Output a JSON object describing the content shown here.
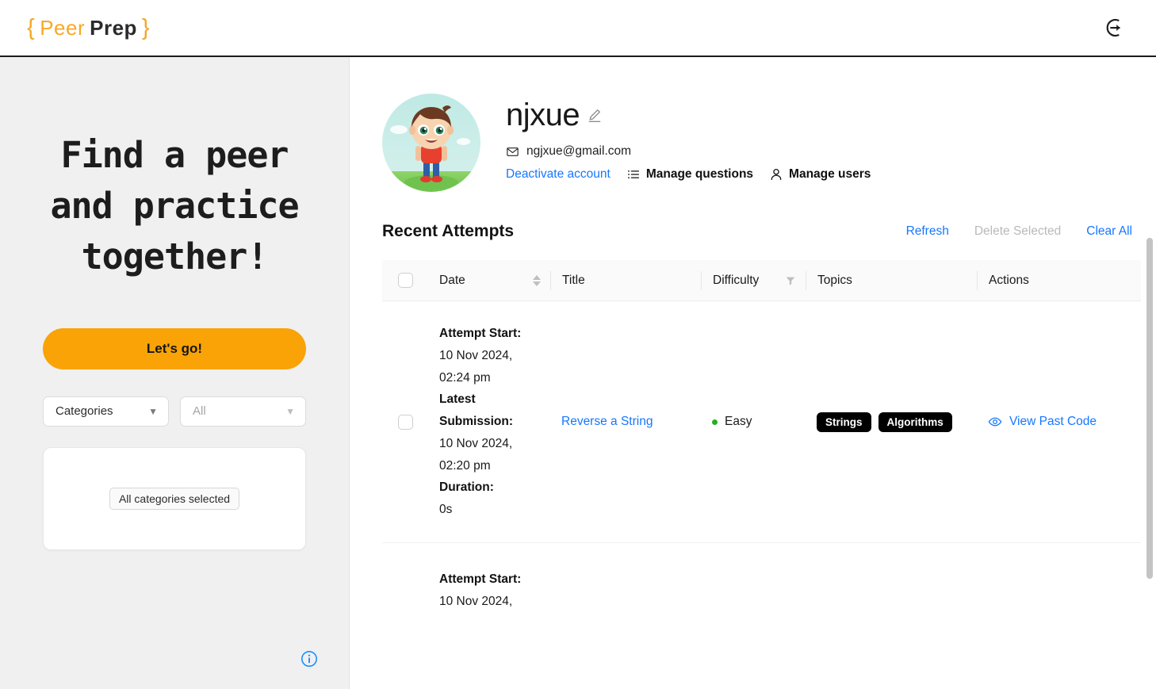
{
  "topbar": {
    "logo": {
      "open_brace": "{",
      "peer": "Peer",
      "prep": "Prep",
      "close_brace": "}"
    },
    "logout_icon": "logout-icon"
  },
  "left_panel": {
    "hero_title": "Find a peer and practice together!",
    "primary_button": "Let's go!",
    "category_select": {
      "value": "Categories",
      "chevron": "chevron-down-icon"
    },
    "difficulty_select": {
      "placeholder": "All",
      "value": "All",
      "chevron": "chevron-down-icon"
    },
    "categories_card": {
      "chip": "All categories selected"
    },
    "info_icon": "info-circle-icon"
  },
  "profile": {
    "avatar_alt": "cartoon-boy-avatar",
    "username": "njxue",
    "edit_icon": "pencil-edit-icon",
    "email": "ngjxue@gmail.com",
    "email_icon": "envelope-icon",
    "deactivate_link": "Deactivate account",
    "manage_questions": {
      "label": "Manage questions",
      "icon": "list-icon"
    },
    "manage_users": {
      "label": "Manage users",
      "icon": "person-icon"
    }
  },
  "attempts": {
    "title": "Recent Attempts",
    "actions": {
      "refresh": "Refresh",
      "delete_selected": "Delete Selected",
      "clear_all": "Clear All"
    },
    "columns": {
      "select_all": "",
      "date": "Date",
      "title": "Title",
      "difficulty": "Difficulty",
      "topics": "Topics",
      "actions": "Actions"
    },
    "column_icons": {
      "date_sort": "sort-arrows-icon",
      "difficulty_filter": "filter-funnel-icon"
    },
    "rows": [
      {
        "attempt_start_label": "Attempt Start:",
        "attempt_start_value": "10 Nov 2024, 02:24 pm",
        "latest_submission_label": "Latest Submission:",
        "latest_submission_value": "10 Nov 2024, 02:20 pm",
        "duration_label": "Duration:",
        "duration_value": "0s",
        "title": "Reverse a String",
        "difficulty": "Easy",
        "difficulty_color": "#26b021",
        "topics": [
          "Strings",
          "Algorithms"
        ],
        "action_label": "View Past Code",
        "action_icon": "eye-icon"
      },
      {
        "attempt_start_label": "Attempt Start:",
        "attempt_start_value": "10 Nov 2024,",
        "latest_submission_label": "",
        "latest_submission_value": "",
        "duration_label": "",
        "duration_value": "",
        "title": "",
        "difficulty": "",
        "difficulty_color": "",
        "topics": [],
        "action_label": "",
        "action_icon": ""
      }
    ]
  },
  "colors": {
    "brand_orange": "#f9a307",
    "link_blue": "#1677ff",
    "panel_grey": "#f0f0f0",
    "tag_black": "#000000",
    "easy_green": "#26b021"
  }
}
